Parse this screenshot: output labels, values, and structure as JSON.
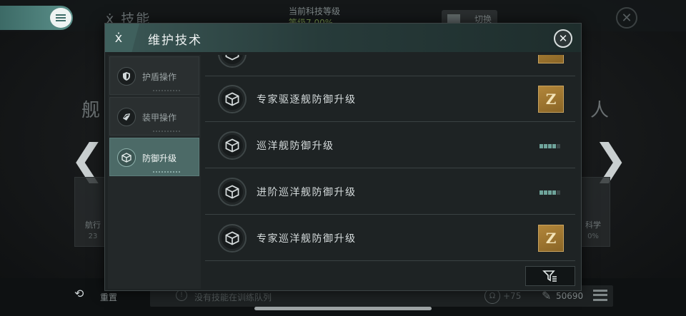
{
  "background": {
    "title": "技能",
    "tech_level_label": "当前科技等级",
    "tech_level_value": "等级7 00%",
    "switch_label": "切换",
    "side_left": "舰",
    "side_right": "人",
    "card_left": {
      "label": "航行",
      "pct": "23"
    },
    "card_right": {
      "label": "科学",
      "pct": "0%"
    },
    "reset_label": "重置",
    "queue_text": "没有技能在训练队列",
    "plus_value": "+75",
    "cost_value": "50690"
  },
  "modal": {
    "title": "维护技术",
    "sidebar": [
      {
        "label": "护盾操作",
        "icon": "shield-icon",
        "active": false
      },
      {
        "label": "装甲操作",
        "icon": "armor-icon",
        "active": false
      },
      {
        "label": "防御升级",
        "icon": "cube-icon",
        "active": true
      }
    ],
    "rows": [
      {
        "name": "专家驱逐舰防御升级",
        "status": "z-badge",
        "badge": "Z"
      },
      {
        "name": "巡洋舰防御升级",
        "status": "progress",
        "progress": 0.8
      },
      {
        "name": "进阶巡洋舰防御升级",
        "status": "progress",
        "progress": 0.8
      },
      {
        "name": "专家巡洋舰防御升级",
        "status": "z-badge",
        "badge": "Z"
      }
    ]
  },
  "colors": {
    "accent": "#4c6a67",
    "progress_on": "#6fa49b",
    "badge_gold": "#b2863a"
  }
}
